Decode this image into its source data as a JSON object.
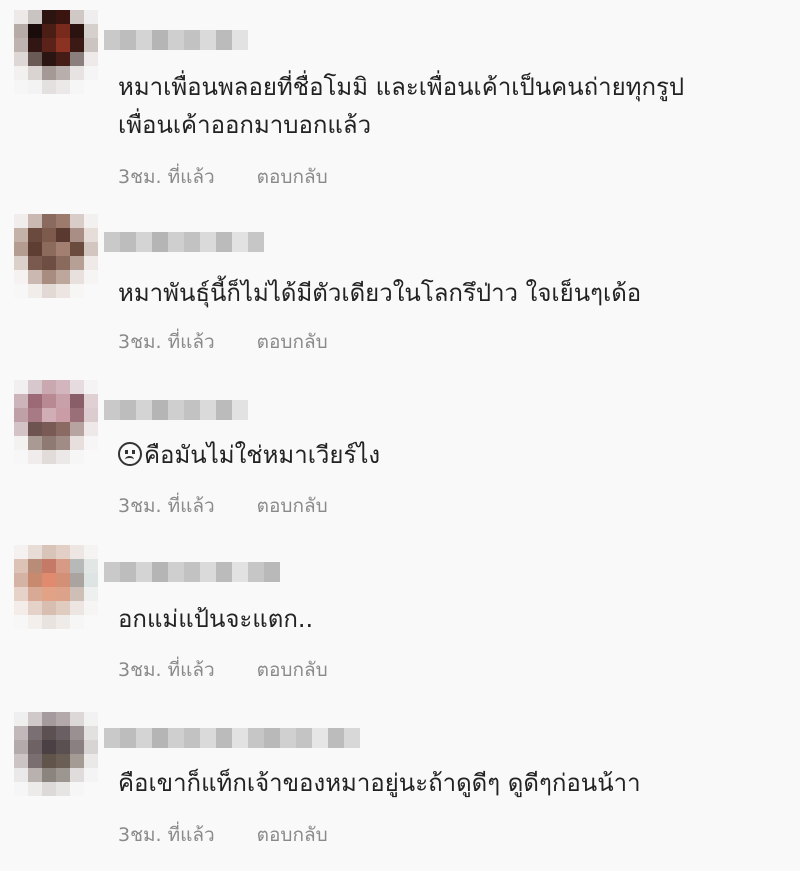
{
  "comments": [
    {
      "lines": [
        "หมาเพื่อนพลอยที่ชื่อโมมิ และเพื่อนเค้าเป็นคนถ่ายทุกรูป",
        "เพื่อนเค้าออกมาบอกแล้ว"
      ],
      "time": "3ชม. ที่แล้ว",
      "reply": "ตอบกลับ"
    },
    {
      "lines": [
        "หมาพันธุ์นี้ก็ไม่ได้มีตัวเดียวในโลกรึป่าว ใจเย็นๆเด้อ"
      ],
      "time": "3ชม. ที่แล้ว",
      "reply": "ตอบกลับ"
    },
    {
      "lines": [
        "คือมันไม่ใช่หมาเวียร์ไง"
      ],
      "emoji": "confused-face-icon",
      "time": "3ชม. ที่แล้ว",
      "reply": "ตอบกลับ"
    },
    {
      "lines": [
        "อกแม่แป้นจะแตก.."
      ],
      "time": "3ชม. ที่แล้ว",
      "reply": "ตอบกลับ"
    },
    {
      "lines": [
        "คือเขาก็แท็กเจ้าของหมาอยู่นะถ้าดูดีๆ ดูดีๆก่อนน้าา"
      ],
      "time": "3ชม. ที่แล้ว",
      "reply": "ตอบกลับ"
    }
  ],
  "colors": {
    "text": "#222222",
    "meta": "#8a8a8a",
    "background": "#f9f9f9"
  }
}
